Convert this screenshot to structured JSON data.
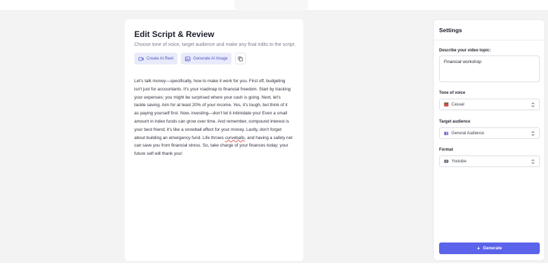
{
  "editor": {
    "title": "Edit Script & Review",
    "subtitle": "Choose tone of voice, target audience and make any final edits to the script.",
    "buttons": {
      "create_reel": "Create AI Reel",
      "generate_image": "Generate AI Image"
    },
    "script": {
      "before_spell": "Let's talk money—specifically, how to make it work for you. First off, budgeting isn't just for accountants. It's your roadmap to financial freedom. Start by tracking your expenses; you might be surprised where your cash is going. Next, let's tackle saving. Aim for at least 20% of your income. Yes, it's tough, but think of it as paying yourself first. Now, investing—don't let it intimidate you! Even a small amount in index funds can grow over time. And remember, compound interest is your best friend; it's like a snowball effect for your money. Lastly, don't forget about building an emergency fund. Life throws ",
      "spell_word": "curveballs",
      "after_spell": ", and having a safety net can save you from financial stress. So, take charge of your finances today; your future self will thank you!"
    }
  },
  "settings": {
    "title": "Settings",
    "topic_label": "Describe your video topic:",
    "topic_value": "Financial workshop",
    "tone_label": "Tone of voice",
    "tone_value": "Casual",
    "audience_label": "Target audience",
    "audience_value": "General Audience",
    "format_label": "Format",
    "format_value": "Youtube",
    "generate_label": "Generate"
  },
  "colors": {
    "accent": "#5b63ea",
    "soft_accent_bg": "#e9ebfb",
    "soft_accent_text": "#4d56c9"
  },
  "icons": {
    "create_reel": "video-icon",
    "generate_image": "image-icon",
    "copy": "copy-icon",
    "tone": "mood-icon",
    "audience": "people-icon",
    "format": "youtube-icon",
    "select": "chevron-updown-icon",
    "generate": "plus-icon"
  }
}
